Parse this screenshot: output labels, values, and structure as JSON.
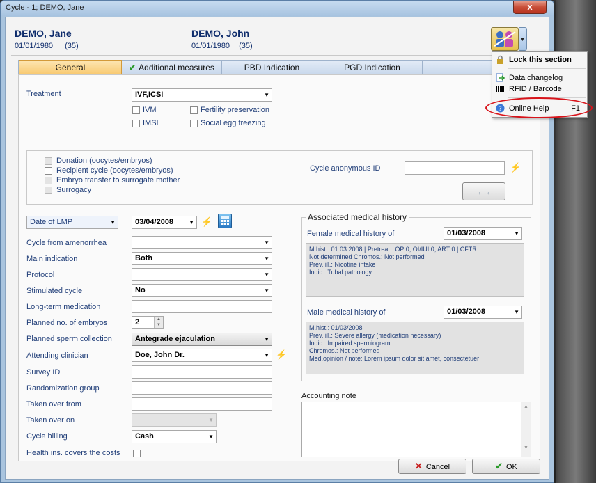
{
  "window": {
    "title": "Cycle - 1; DEMO, Jane",
    "close_glyph": "x"
  },
  "patients": {
    "female": {
      "name": "DEMO, Jane",
      "dob": "01/01/1980",
      "age": "(35)"
    },
    "male": {
      "name": "DEMO, John",
      "dob": "01/01/1980",
      "age": "(35)"
    }
  },
  "tabs": [
    {
      "label": "General",
      "active": true
    },
    {
      "label": "Additional measures",
      "check": "✔"
    },
    {
      "label": "PBD Indication"
    },
    {
      "label": "PGD Indication"
    }
  ],
  "treatment": {
    "label": "Treatment",
    "value": "IVF,ICSI",
    "options": [
      {
        "label": "IVM",
        "checked": false
      },
      {
        "label": "Fertility preservation",
        "checked": false
      },
      {
        "label": "IMSI",
        "checked": false
      },
      {
        "label": "Social egg freezing",
        "checked": false
      }
    ]
  },
  "cycle_type": {
    "options": [
      {
        "label": "Donation (oocytes/embryos)",
        "enabled": false
      },
      {
        "label": "Recipient cycle (oocytes/embryos)",
        "enabled": true
      },
      {
        "label": "Embryo transfer to surrogate mother",
        "enabled": false
      },
      {
        "label": "Surrogacy",
        "enabled": false
      }
    ],
    "anon_id_label": "Cycle anonymous ID",
    "anon_id_value": "",
    "transfer_glyph": "→ ←"
  },
  "dates": {
    "lmp_selector": "Date of LMP",
    "lmp_value": "03/04/2008"
  },
  "fields": [
    {
      "label": "Cycle from amenorrhea",
      "value": "",
      "kind": "combo"
    },
    {
      "label": "Main indication",
      "value": "Both",
      "kind": "combo"
    },
    {
      "label": "Protocol",
      "value": "",
      "kind": "combo"
    },
    {
      "label": "Stimulated cycle",
      "value": "No",
      "kind": "combo"
    },
    {
      "label": "Long-term medication",
      "value": "",
      "kind": "text"
    },
    {
      "label": "Planned no. of embryos",
      "value": "2",
      "kind": "spin"
    },
    {
      "label": "Planned sperm collection",
      "value": "Antegrade ejaculation",
      "kind": "combo-dark"
    },
    {
      "label": "Attending clinician",
      "value": "Doe, John Dr.",
      "kind": "combo"
    },
    {
      "label": "Survey ID",
      "value": "",
      "kind": "text"
    },
    {
      "label": "Randomization group",
      "value": "",
      "kind": "text"
    },
    {
      "label": "Taken over from",
      "value": "",
      "kind": "text"
    },
    {
      "label": "Taken over on",
      "value": "",
      "kind": "combo-disabled"
    },
    {
      "label": "Cycle billing",
      "value": "Cash",
      "kind": "combo-short"
    },
    {
      "label": "Health ins. covers the costs",
      "value": "",
      "kind": "check"
    }
  ],
  "history": {
    "group_label": "Associated medical history",
    "female_label": "Female medical history of",
    "female_date": "01/03/2008",
    "female_lines": [
      "M.hist.: 01.03.2008  |  Pretreat.:  OP  0,  OI/IUI 0,  ART 0  |  CFTR:",
      "Not determined Chromos.: Not performed",
      "Prev. ill.: Nicotine intake",
      "Indic.: Tubal pathology"
    ],
    "male_label": "Male medical history of",
    "male_date": "01/03/2008",
    "male_lines": [
      "M.hist.: 01/03/2008",
      "Prev. ill.: Severe allergy (medication necessary)",
      "Indic.: Impaired spermiogram",
      "Chromos.: Not performed",
      "Med.opinion / note: Lorem ipsum dolor sit amet, consectetuer"
    ]
  },
  "accounting": {
    "label": "Accounting note",
    "value": ""
  },
  "buttons": {
    "cancel": "Cancel",
    "ok": "OK"
  },
  "menu": {
    "items": [
      {
        "label": "Lock this section",
        "bold": true,
        "icon": "lock-icon"
      },
      {
        "label": "Data changelog",
        "icon": "changelog-icon"
      },
      {
        "label": "RFID / Barcode",
        "icon": "barcode-icon"
      },
      {
        "label": "Online Help",
        "shortcut": "F1",
        "icon": "help-icon"
      }
    ]
  },
  "colors": {
    "accent_tab": "#f8c970",
    "label_blue": "#23407a",
    "highlight_red": "#d8131a",
    "lightning": "#d7c300"
  }
}
